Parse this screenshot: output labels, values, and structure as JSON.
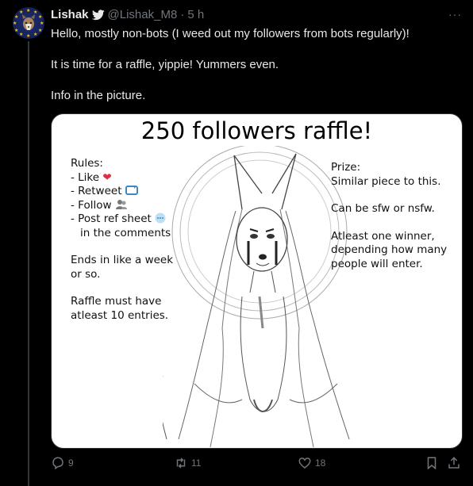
{
  "user": {
    "display_name": "Lishak",
    "handle": "@Lishak_M8",
    "separator": "·",
    "time_ago": "5 h"
  },
  "more_label": "···",
  "tweet": {
    "line1": "Hello, mostly non-bots (I weed out my followers from bots regularly)!",
    "line2": "It is time for a raffle, yippie! Yummers even.",
    "line3": "Info in the picture."
  },
  "image": {
    "title": "250 followers raffle!",
    "rules": {
      "heading": "Rules:",
      "items": [
        "- Like",
        "- Retweet",
        "- Follow",
        "- Post ref sheet",
        "in the comments"
      ],
      "ends_1": "Ends in like a week",
      "ends_2": "or so.",
      "min_1": "Raffle must have",
      "min_2": "atleast 10 entries."
    },
    "prize": {
      "heading": "Prize:",
      "desc": "Similar piece to this.",
      "sfw": "Can be sfw or nsfw.",
      "w1": "Atleast one winner,",
      "w2": "depending how many",
      "w3": "people will enter."
    }
  },
  "actions": {
    "replies": "9",
    "retweets": "11",
    "likes": "18"
  },
  "colors": {
    "background": "#000000",
    "text": "#e7e9ea",
    "muted": "#71767b",
    "heart": "#e0245e",
    "retweet": "#1d9bf0"
  }
}
